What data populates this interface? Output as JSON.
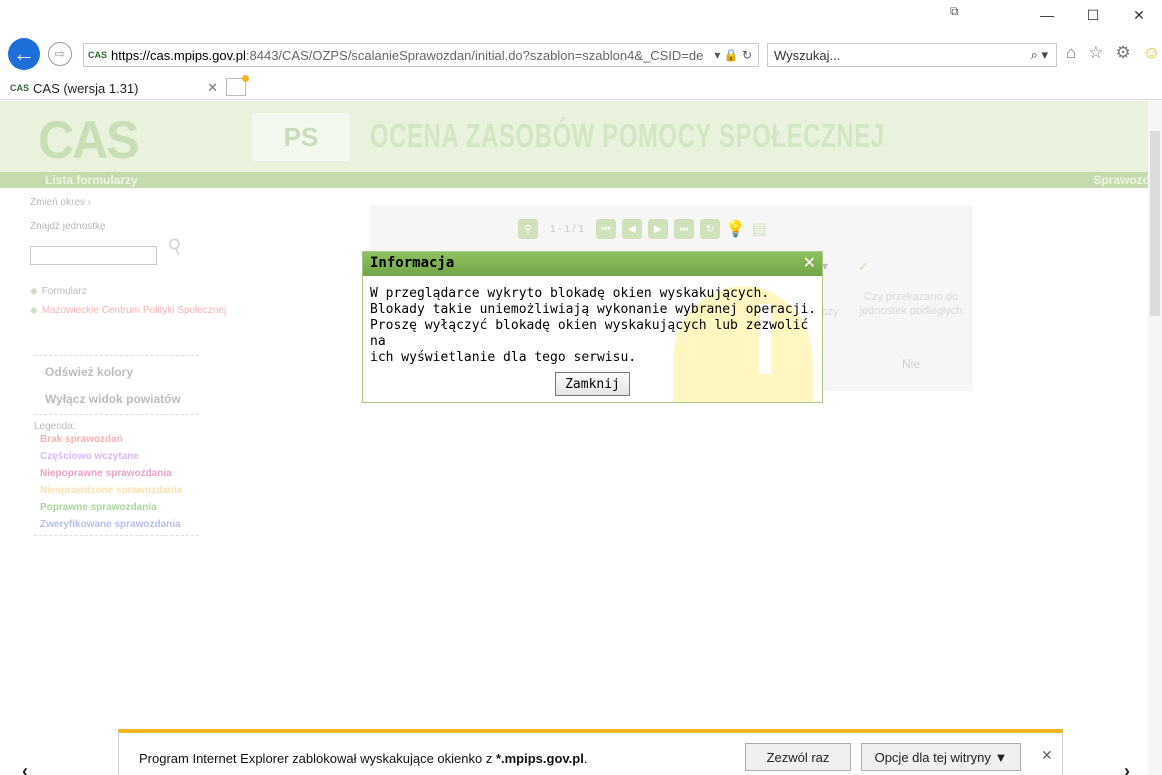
{
  "browser": {
    "window_controls": [
      "—",
      "☐",
      "✕"
    ],
    "url_host": "https://cas.mpips.gov.pl",
    "url_rest": ":8443/CAS/OZPS/scalanieSprawozdan/initial.do?szablon=szablon4&_CSID=de",
    "url_icons": "▾ 🔒 ↻",
    "search_placeholder": "Wyszukaj...",
    "search_go": "⌕ ▾",
    "tab_title": "CAS (wersja 1.31)",
    "tab_close": "✕",
    "favicon": "CAS"
  },
  "header": {
    "logo": "CAS",
    "module": "PS",
    "title": "OCENA ZASOBÓW POMOCY SPOŁECZNEJ",
    "nav_left": "Lista formularzy",
    "nav_right": "Sprawozd"
  },
  "sidebar": {
    "change_period": "Zmień okres ›",
    "find_unit": "Znajdź jednostkę",
    "tree": [
      "Formularz",
      "Mazowieckie Centrum Polityki Społecznej"
    ],
    "refresh_colors": "Odśwież kolory",
    "disable_counties": "Wyłącz widok powiatów",
    "legend_title": "Legenda:",
    "legend": [
      {
        "label": "Brak sprawozdań",
        "color": "#f4b2b2"
      },
      {
        "label": "Częściowo wczytane",
        "color": "#d8b9f0"
      },
      {
        "label": "Niepoprawne sprawozdania",
        "color": "#e9a3c4"
      },
      {
        "label": "Niesprawdzone sprawozdania",
        "color": "#fbe0b0"
      },
      {
        "label": "Poprawne sprawozdania",
        "color": "#a9d59a"
      },
      {
        "label": "Zweryfikowane sprawozdania",
        "color": "#b9bee8"
      }
    ]
  },
  "table": {
    "pager": "1 - 1 / 1",
    "column_header": "Czy przekazano do jednostek podległych",
    "column_fragment": "czy",
    "value": "Nie"
  },
  "dialog": {
    "title": "Informacja",
    "close": "✕",
    "message_lines": [
      "W przeglądarce wykryto blokadę okien wyskakujących.",
      "Blokady takie uniemożliwiają wykonanie wybranej operacji.",
      "Proszę wyłączyć blokadę okien wyskakujących lub zezwolić na",
      "ich wyświetlanie dla tego serwisu."
    ],
    "button": "Zamknij"
  },
  "notification": {
    "text_prefix": "Program Internet Explorer zablokował wyskakujące okienko z ",
    "domain": "*.mpips.gov.pl",
    "text_suffix": ".",
    "allow_once": "Zezwól raz",
    "site_options": "Opcje dla tej witryny ▼",
    "close": "✕"
  }
}
